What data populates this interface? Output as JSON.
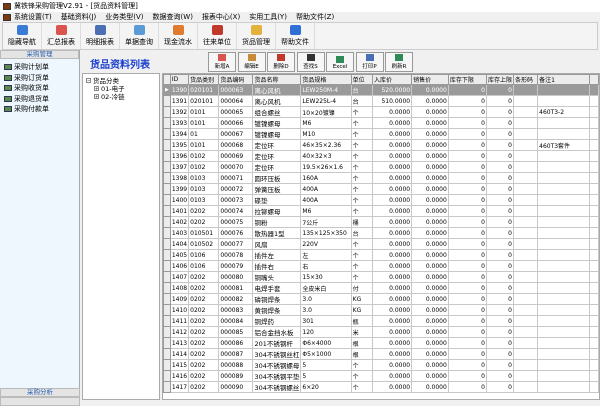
{
  "window": {
    "title": "冀铁锋采购管理V2.91 - [货品资料管理]"
  },
  "menu": [
    "系统设置(T)",
    "基础资料(J)",
    "业务类型(V)",
    "数据查询(W)",
    "报表中心(X)",
    "实用工具(Y)",
    "帮助文件(Z)"
  ],
  "toolbar": [
    {
      "label": "隐藏导航",
      "icon": "monitor-icon",
      "color": "#3a7bd5"
    },
    {
      "label": "汇总报表",
      "icon": "pie-report-icon",
      "color": "#d9534f"
    },
    {
      "label": "明细报表",
      "icon": "bar-report-icon",
      "color": "#4a6fb5"
    },
    {
      "label": "单据查询",
      "icon": "magnifier-doc-icon",
      "color": "#5b9bd5"
    },
    {
      "label": "现金流水",
      "icon": "cash-icon",
      "color": "#e07a2e"
    },
    {
      "label": "往来单位",
      "icon": "partners-icon",
      "color": "#c0392b"
    },
    {
      "label": "货品管理",
      "icon": "goods-icon",
      "color": "#e3b23c"
    },
    {
      "label": "帮助文件",
      "icon": "help-icon",
      "color": "#2f6fd6"
    }
  ],
  "sidebar": {
    "header": "采购管理",
    "items": [
      "采购计划单",
      "采购订货单",
      "采购收货单",
      "采购退货单",
      "采购付款单"
    ],
    "footer": "采购分析"
  },
  "page": {
    "title": "货品资料列表"
  },
  "actions": [
    {
      "label": "新增A",
      "icon": "add-icon",
      "color": "#d9534f"
    },
    {
      "label": "编辑E",
      "icon": "edit-icon",
      "color": "#c78a3a"
    },
    {
      "label": "删除D",
      "icon": "delete-icon",
      "color": "#c0392b"
    },
    {
      "label": "查找S",
      "icon": "binoculars-icon",
      "color": "#333333"
    },
    {
      "label": "Excel",
      "icon": "excel-icon",
      "color": "#2e8b57"
    },
    {
      "label": "打印P",
      "icon": "print-icon",
      "color": "#4a6fb5"
    },
    {
      "label": "刷新R",
      "icon": "refresh-icon",
      "color": "#2e8b57"
    }
  ],
  "tree": {
    "root": "货品分类",
    "children": [
      "01-电子",
      "02-冷链"
    ]
  },
  "table": {
    "columns": [
      "ID",
      "货品类别",
      "货品编码",
      "货品名称",
      "货品规格",
      "单位",
      "入库价",
      "销售价",
      "库存下限",
      "库存上限",
      "条形码",
      "备注1"
    ],
    "selected_index": 0,
    "rows": [
      [
        "1390",
        "020101",
        "000063",
        "离心风机",
        "LEW250M-4",
        "台",
        "520.0000",
        "0.0000",
        "0",
        "0",
        "",
        ""
      ],
      [
        "1391",
        "020101",
        "000064",
        "离心风机",
        "LEW225L-4",
        "台",
        "510.0000",
        "0.0000",
        "0",
        "0",
        "",
        ""
      ],
      [
        "1392",
        "0101",
        "000065",
        "组合螺丝",
        "10×20镀镍",
        "个",
        "0.0000",
        "0.0000",
        "0",
        "0",
        "",
        "460T3-2"
      ],
      [
        "1393",
        "0101",
        "000066",
        "镀镍螺母",
        "M6",
        "个",
        "0.0000",
        "0.0000",
        "0",
        "0",
        "",
        ""
      ],
      [
        "1394",
        "01",
        "000067",
        "镀镍螺母",
        "M10",
        "个",
        "0.0000",
        "0.0000",
        "0",
        "0",
        "",
        ""
      ],
      [
        "1395",
        "0101",
        "000068",
        "定位环",
        "46×35×2.36",
        "个",
        "0.0000",
        "0.0000",
        "0",
        "0",
        "",
        "460T3套件"
      ],
      [
        "1396",
        "0102",
        "000069",
        "定位环",
        "40×32×3",
        "个",
        "0.0000",
        "0.0000",
        "0",
        "0",
        "",
        ""
      ],
      [
        "1397",
        "0102",
        "000070",
        "定位环",
        "19.5×26×1.6",
        "个",
        "0.0000",
        "0.0000",
        "0",
        "0",
        "",
        ""
      ],
      [
        "1398",
        "0103",
        "000071",
        "圆环压板",
        "160A",
        "个",
        "0.0000",
        "0.0000",
        "0",
        "0",
        "",
        ""
      ],
      [
        "1399",
        "0103",
        "000072",
        "弹簧压板",
        "400A",
        "个",
        "0.0000",
        "0.0000",
        "0",
        "0",
        "",
        ""
      ],
      [
        "1400",
        "0103",
        "000073",
        "碟垫",
        "400A",
        "个",
        "0.0000",
        "0.0000",
        "0",
        "0",
        "",
        ""
      ],
      [
        "1401",
        "0202",
        "000074",
        "拉铆螺母",
        "M6",
        "个",
        "0.0000",
        "0.0000",
        "0",
        "0",
        "",
        ""
      ],
      [
        "1402",
        "0202",
        "000075",
        "铜粉",
        "7公斤",
        "桶",
        "0.0000",
        "0.0000",
        "0",
        "0",
        "",
        ""
      ],
      [
        "1403",
        "010501",
        "000076",
        "散热器1型",
        "135×125×350",
        "台",
        "0.0000",
        "0.0000",
        "0",
        "0",
        "",
        ""
      ],
      [
        "1404",
        "010502",
        "000077",
        "风扇",
        "220V",
        "个",
        "0.0000",
        "0.0000",
        "0",
        "0",
        "",
        ""
      ],
      [
        "1405",
        "0106",
        "000078",
        "插件左",
        "左",
        "个",
        "0.0000",
        "0.0000",
        "0",
        "0",
        "",
        ""
      ],
      [
        "1406",
        "0106",
        "000079",
        "插件右",
        "右",
        "个",
        "0.0000",
        "0.0000",
        "0",
        "0",
        "",
        ""
      ],
      [
        "1407",
        "0202",
        "000080",
        "铜嘴头",
        "15×30",
        "个",
        "0.0000",
        "0.0000",
        "0",
        "0",
        "",
        ""
      ],
      [
        "1408",
        "0202",
        "000081",
        "电焊手套",
        "全皮米白",
        "付",
        "0.0000",
        "0.0000",
        "0",
        "0",
        "",
        ""
      ],
      [
        "1409",
        "0202",
        "000082",
        "磷铜焊条",
        "3.0",
        "KG",
        "0.0000",
        "0.0000",
        "0",
        "0",
        "",
        ""
      ],
      [
        "1410",
        "0202",
        "000083",
        "黄铜焊条",
        "3.0",
        "KG",
        "0.0000",
        "0.0000",
        "0",
        "0",
        "",
        ""
      ],
      [
        "1411",
        "0202",
        "000084",
        "铜焊药",
        "301",
        "瓶",
        "0.0000",
        "0.0000",
        "0",
        "0",
        "",
        ""
      ],
      [
        "1412",
        "0202",
        "000085",
        "铝合金挡水板",
        "120",
        "米",
        "0.0000",
        "0.0000",
        "0",
        "0",
        "",
        ""
      ],
      [
        "1413",
        "0202",
        "000086",
        "201不锈钢杆",
        "Φ6×4000",
        "根",
        "0.0000",
        "0.0000",
        "0",
        "0",
        "",
        ""
      ],
      [
        "1414",
        "0202",
        "000087",
        "304不锈钢丝杠",
        "Φ5×1000",
        "根",
        "0.0000",
        "0.0000",
        "0",
        "0",
        "",
        ""
      ],
      [
        "1415",
        "0202",
        "000088",
        "304不锈钢螺母",
        "5",
        "个",
        "0.0000",
        "0.0000",
        "0",
        "0",
        "",
        ""
      ],
      [
        "1416",
        "0202",
        "000089",
        "304不锈钢平垫",
        "5",
        "个",
        "0.0000",
        "0.0000",
        "0",
        "0",
        "",
        ""
      ],
      [
        "1417",
        "0202",
        "000090",
        "304不锈钢螺丝",
        "6×20",
        "个",
        "0.0000",
        "0.0000",
        "0",
        "0",
        "",
        ""
      ]
    ]
  }
}
